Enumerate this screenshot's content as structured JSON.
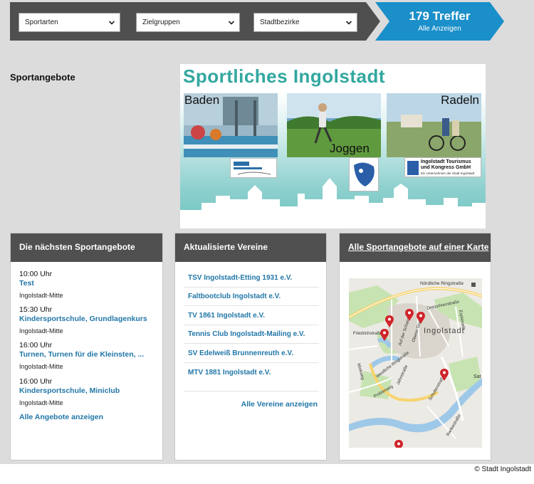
{
  "filters": {
    "sportarten": "Sportarten",
    "zielgruppen": "Zielgruppen",
    "stadtbezirke": "Stadtbezirke"
  },
  "results": {
    "count_label": "179 Treffer",
    "all_label": "Alle Anzeigen"
  },
  "section_title": "Sportangebote",
  "banner": {
    "title": "Sportliches Ingolstadt",
    "baden": "Baden",
    "joggen": "Joggen",
    "radeln": "Radeln",
    "partner_text": "Ingolstadt Tourismus und Kongress GmbH",
    "partner_sub": "Ein Unternehmen der Stadt Ingolstadt"
  },
  "upcoming": {
    "header": "Die nächsten Sportangebote",
    "events": [
      {
        "time": "10:00 Uhr",
        "title": "Test",
        "location": "Ingolstadt-Mitte"
      },
      {
        "time": "15:30 Uhr",
        "title": "Kindersportschule, Grundlagenkurs",
        "location": "Ingolstadt-Mitte"
      },
      {
        "time": "16:00 Uhr",
        "title": "Turnen, Turnen für die Kleinsten, ...",
        "location": "Ingolstadt-Mitte"
      },
      {
        "time": "16:00 Uhr",
        "title": "Kindersportschule, Miniclub",
        "location": "Ingolstadt-Mitte"
      }
    ],
    "all_link": "Alle Angebote anzeigen"
  },
  "clubs": {
    "header": "Aktualisierte Vereine",
    "items": [
      "TSV Ingolstadt-Etting 1931 e.V.",
      "Faltbootclub Ingolstadt e.V.",
      "TV 1861 Ingolstadt e.V.",
      "Tennis Club Ingolstadt-Mailing e.V.",
      "SV Edelweiß Brunnenreuth e.V.",
      "MTV 1881 Ingolstadt e.V."
    ],
    "all_link": "Alle Vereine anzeigen"
  },
  "map_card": {
    "header": "Alle Sportangebote auf einer Karte",
    "labels": {
      "city": "Ingolstadt",
      "nordliche": "Nördliche Ringstraße",
      "dreizehner": "Dreizehnerstraße",
      "esplanade": "Esplanade",
      "westliche": "Westliche Ringstraße",
      "jahnstrasse": "Jahnstraße",
      "schutter": "Schutterstraße",
      "probierweg": "Probierweg",
      "ranke": "Rankestraße",
      "auf_der_schanz": "Auf der Schanz",
      "oberer_graben": "Oberer Graben",
      "friedrichstr": "Friedrichstraße",
      "sat": "Sat",
      "minkweg": "Minkweg"
    }
  },
  "copyright": "© Stadt Ingolstadt"
}
